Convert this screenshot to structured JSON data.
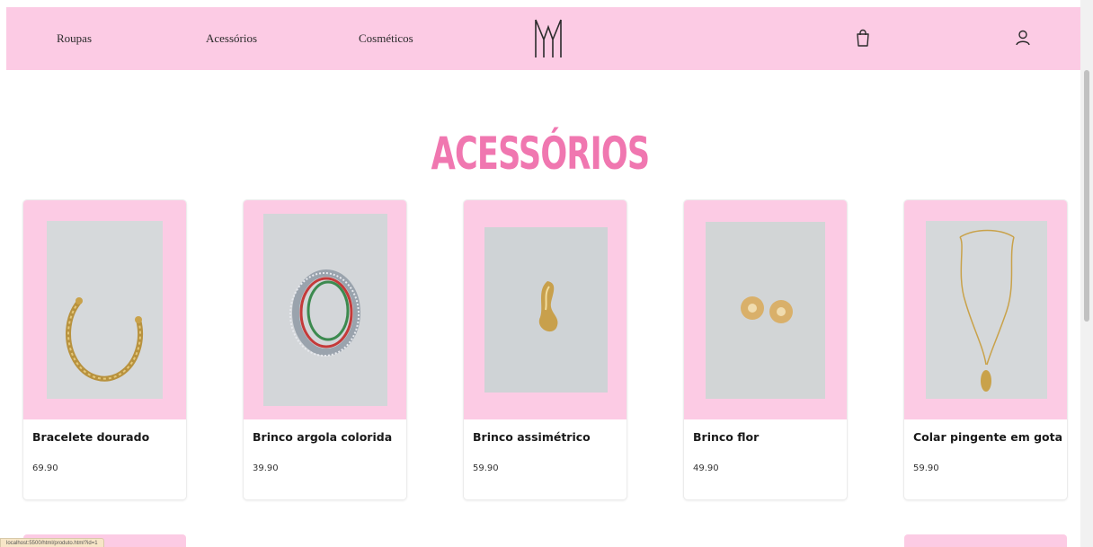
{
  "nav": {
    "links": [
      "Roupas",
      "Acessórios",
      "Cosméticos"
    ],
    "logo_text": "M",
    "cart_icon": "shopping-bag-icon",
    "user_icon": "user-icon"
  },
  "page": {
    "title": "ACESSÓRIOS"
  },
  "products": [
    {
      "name": "Bracelete dourado",
      "price": "69.90"
    },
    {
      "name": "Brinco argola colorida",
      "price": "39.90"
    },
    {
      "name": "Brinco assimétrico",
      "price": "59.90"
    },
    {
      "name": "Brinco flor",
      "price": "49.90"
    },
    {
      "name": "Colar pingente em gota",
      "price": "59.90"
    }
  ],
  "status": {
    "url": "localhost:5500/html/produto.html?id=1"
  },
  "colors": {
    "header_bg": "#fccbe4",
    "title_pink": "#f077b0",
    "card_media_bg": "#fccbe4"
  }
}
